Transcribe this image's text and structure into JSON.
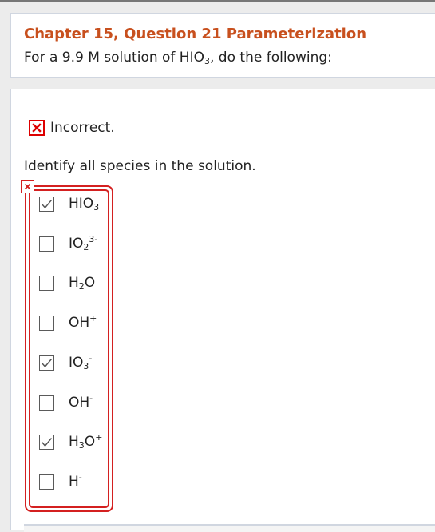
{
  "header": {
    "title": "Chapter 15, Question 21 Parameterization",
    "subtitle_prefix": "For a 9.9 M solution of HIO",
    "subtitle_sub": "3",
    "subtitle_suffix": ", do the following:"
  },
  "feedback": {
    "status": "Incorrect.",
    "status_icon": "red-x-icon",
    "color": "#d42020"
  },
  "question": {
    "prompt": "Identify all species in the solution."
  },
  "options": [
    {
      "base": "HIO",
      "sub": "3",
      "sup": "",
      "checked": true
    },
    {
      "base": "IO",
      "sub": "2",
      "sup": "3-",
      "checked": false
    },
    {
      "base": "H",
      "sub": "2",
      "tail": "O",
      "sup": "",
      "checked": false
    },
    {
      "base": "OH",
      "sub": "",
      "sup": "+",
      "checked": false
    },
    {
      "base": "IO",
      "sub": "3",
      "sup": "-",
      "checked": true
    },
    {
      "base": "OH",
      "sub": "",
      "sup": "-",
      "checked": false
    },
    {
      "base": "H",
      "sub": "3",
      "tail": "O",
      "sup": "+",
      "checked": true
    },
    {
      "base": "H",
      "sub": "",
      "sup": "-",
      "checked": false
    }
  ],
  "colors": {
    "title": "#c8501e",
    "error": "#d42020",
    "panel_border": "#d0d6e0"
  }
}
